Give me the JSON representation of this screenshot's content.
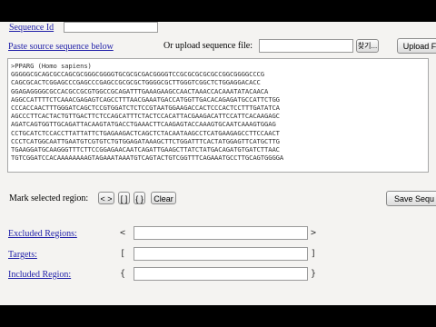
{
  "header": {
    "sequence_id_label": "Sequence Id",
    "paste_label": "Paste source sequence below",
    "upload_label": "Or upload sequence file:",
    "browse_label": "찾기...",
    "upload_button": "Upload F"
  },
  "sequence": {
    "lines": [
      ">PPARG (Homo sapiens)",
      "GGGGGCGCAGCGCCAGCGCGGGCGGGGTGCGCGCGACGGGGTCCGCGCGCGCGCCGGCGGGGCCCG",
      "CAGCGCACTCGGAGCCCGAGCCCGAGCCGCGCGCTGGGGCGCTTGGGTCGGCTCTGGAGGACACC",
      "GGAGAGGGGCGCCACGCCGCGTGGCCGCAGATTTGAAAGAAGCCAACTAAACCACAAATATACAACA",
      "AGGCCATTTTCTCAAACGAGAGTCAGCCTTTAACGAAATGACCATGGTTGACACAGAGATGCCATTCTGG",
      "CCCACCAACTTTGGGATCAGCTCCGTGGATCTCTCCGTAATGGAAGACCACTCCCACTCCTTTGATATCA",
      "AGCCCTTCACTACTGTTGACTTCTCCAGCATTTCTACTCCACATTACGAAGACATTCCATTCACAAGAGC",
      "AGATCAGTGGTTGCAGATTACAAGTATGACCTGAAACTTCAAGAGTACCAAAGTGCAATCAAAGTGGAG",
      "CCTGCATCTCCACCTTATTATTCTGAGAAGACTCAGCTCTACAATAAGCCTCATGAAGAGCCTTCCAACT",
      "CCCTCATGGCAATTGAATGTCGTGTCTGTGGAGATAAAGCTTCTGGATTTCACTATGGAGTTCATGCTTG",
      "TGAAGGATGCAAGGGTTTCTTCCGGAGAACAATCAGATTGAAGCTTATCTATGACAGATGTGATCTTAAC",
      "TGTCGGATCCACAAAAAAAAGTAGAAATAAATGTCAGTACTGTCGGTTTCAGAAATGCCTTGCAGTGGGGA"
    ]
  },
  "mark": {
    "label": "Mark selected region:",
    "btn1": "< >",
    "btn2": "[ ]",
    "btn3": "{ }",
    "clear": "Clear",
    "save": "Save Sequ"
  },
  "regions": {
    "excluded_label": "Excluded Regions:",
    "excluded_open": "<",
    "excluded_close": ">",
    "targets_label": "Targets:",
    "targets_open": "[",
    "targets_close": "]",
    "included_label": "Included Region:",
    "included_open": "{",
    "included_close": "}"
  }
}
